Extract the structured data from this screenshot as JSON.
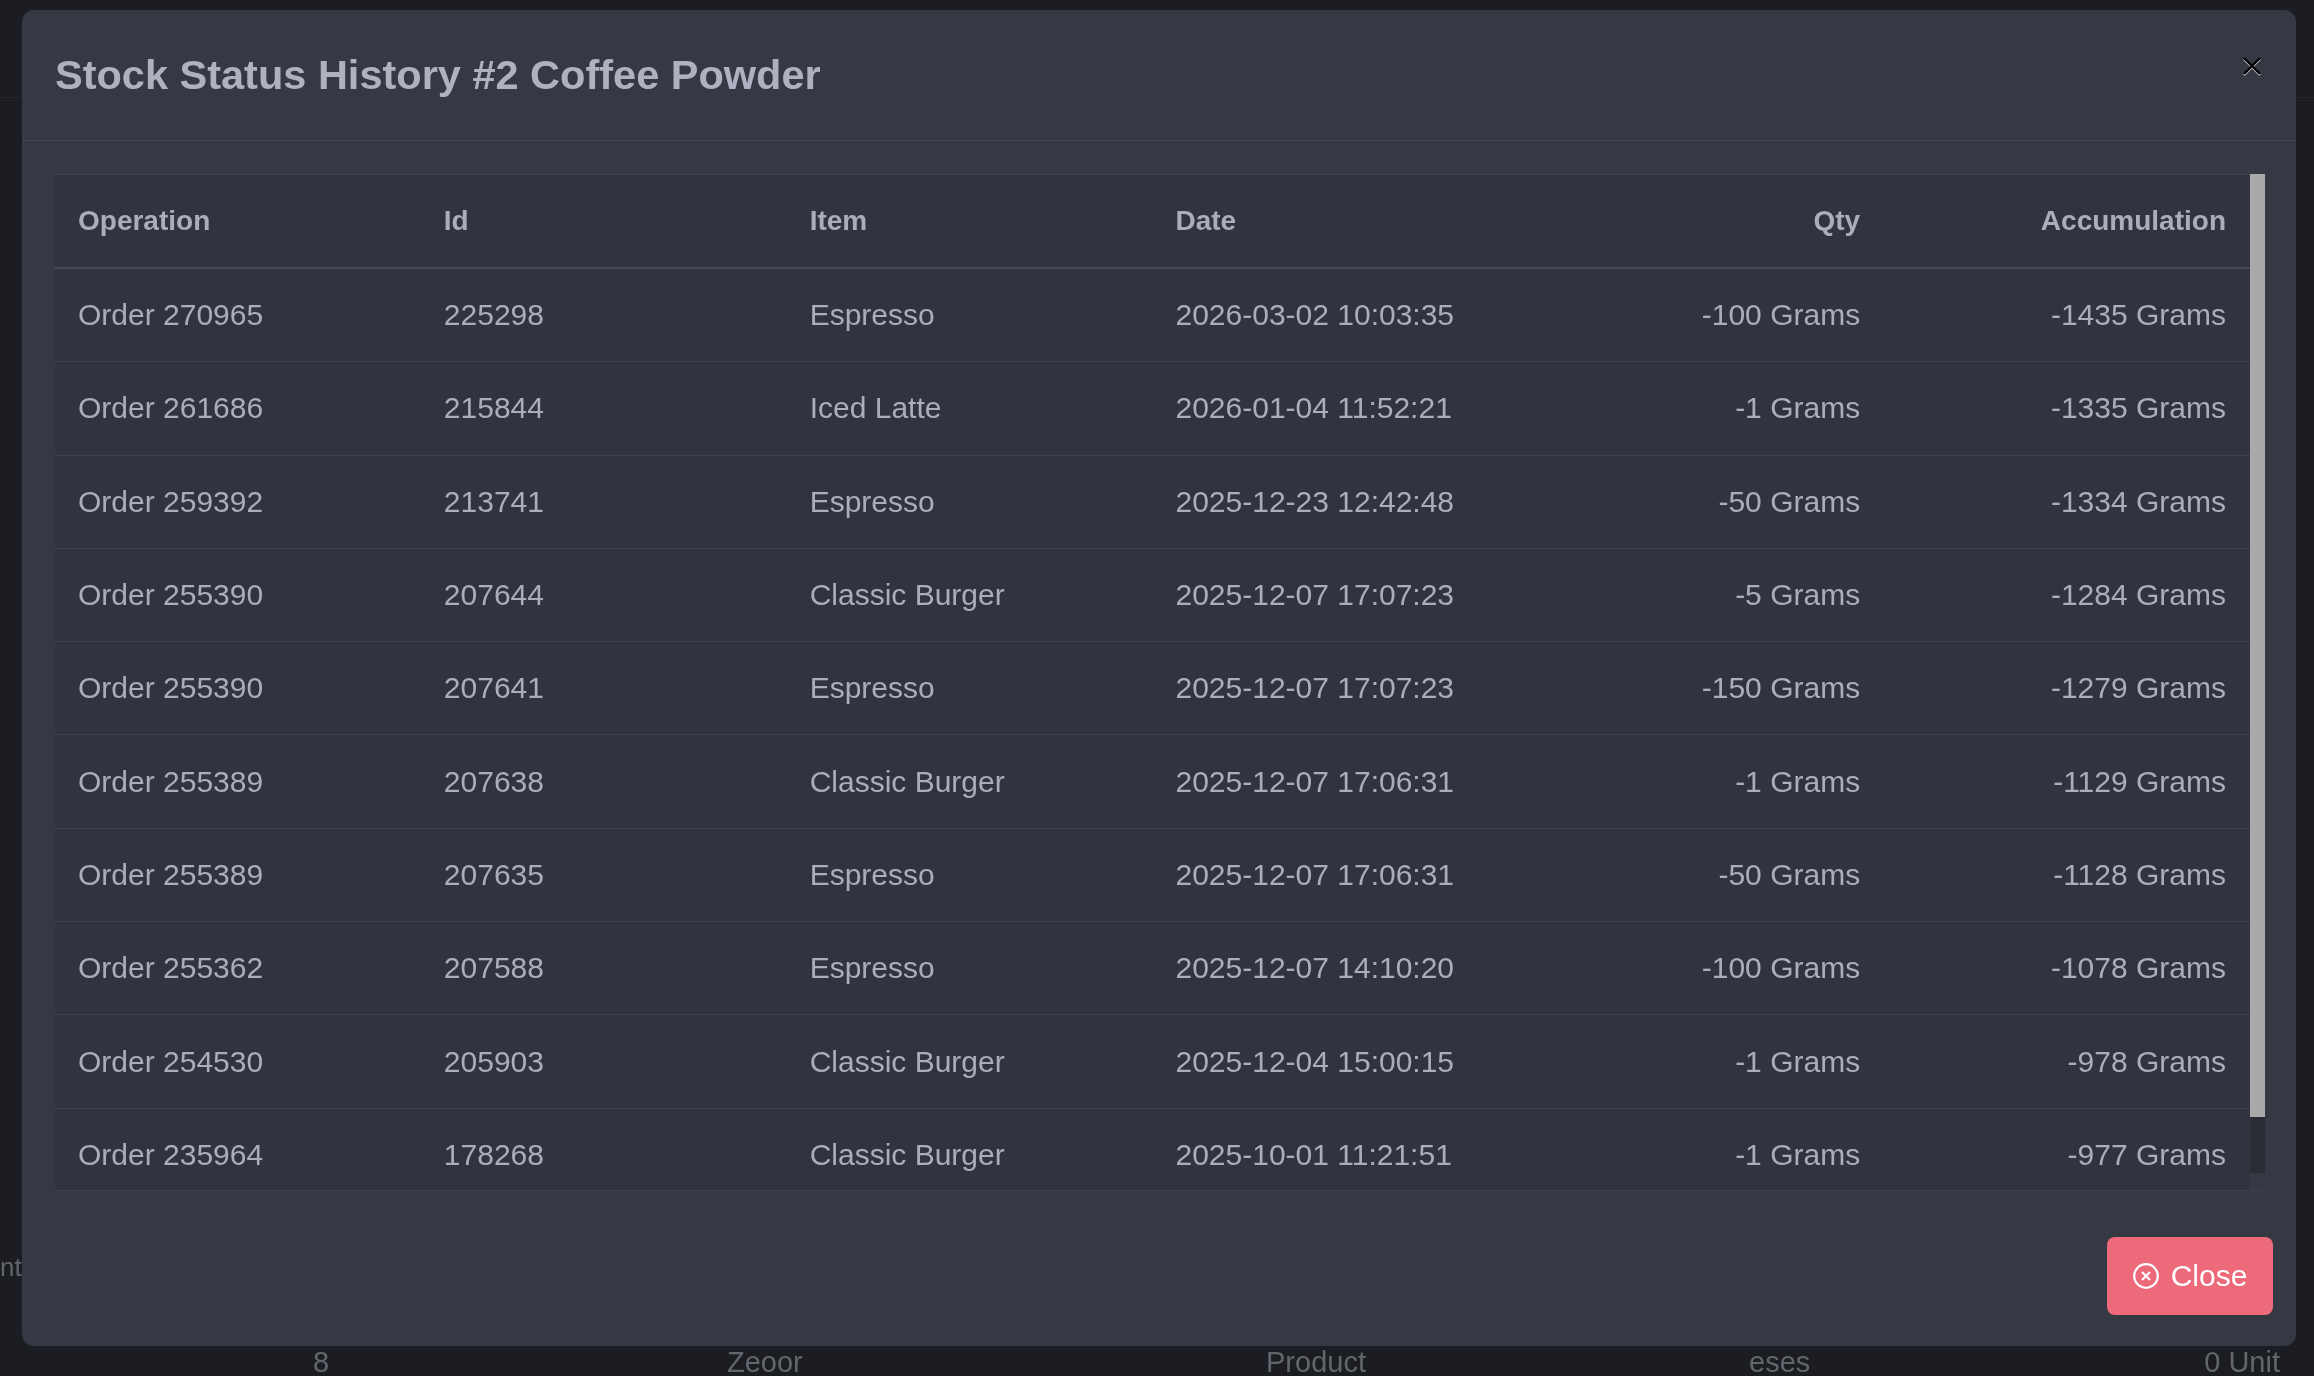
{
  "background": {
    "side_label": "nt",
    "bottom_row": [
      "8",
      "Zeoor",
      "Product",
      "eses",
      "0 Unit"
    ]
  },
  "modal": {
    "title": "Stock Status History #2 Coffee Powder",
    "table": {
      "columns": [
        {
          "label": "Operation",
          "kind": "text"
        },
        {
          "label": "Id",
          "kind": "text"
        },
        {
          "label": "Item",
          "kind": "text"
        },
        {
          "label": "Date",
          "kind": "text"
        },
        {
          "label": "Qty",
          "kind": "number"
        },
        {
          "label": "Accumulation",
          "kind": "number"
        }
      ],
      "rows": [
        [
          "Order 270965",
          "225298",
          "Espresso",
          "2026-03-02 10:03:35",
          "-100 Grams",
          "-1435 Grams"
        ],
        [
          "Order 261686",
          "215844",
          "Iced Latte",
          "2026-01-04 11:52:21",
          "-1 Grams",
          "-1335 Grams"
        ],
        [
          "Order 259392",
          "213741",
          "Espresso",
          "2025-12-23 12:42:48",
          "-50 Grams",
          "-1334 Grams"
        ],
        [
          "Order 255390",
          "207644",
          "Classic Burger",
          "2025-12-07 17:07:23",
          "-5 Grams",
          "-1284 Grams"
        ],
        [
          "Order 255390",
          "207641",
          "Espresso",
          "2025-12-07 17:07:23",
          "-150 Grams",
          "-1279 Grams"
        ],
        [
          "Order 255389",
          "207638",
          "Classic Burger",
          "2025-12-07 17:06:31",
          "-1 Grams",
          "-1129 Grams"
        ],
        [
          "Order 255389",
          "207635",
          "Espresso",
          "2025-12-07 17:06:31",
          "-50 Grams",
          "-1128 Grams"
        ],
        [
          "Order 255362",
          "207588",
          "Espresso",
          "2025-12-07 14:10:20",
          "-100 Grams",
          "-1078 Grams"
        ],
        [
          "Order 254530",
          "205903",
          "Classic Burger",
          "2025-12-04 15:00:15",
          "-1 Grams",
          "-978 Grams"
        ],
        [
          "Order 235964",
          "178268",
          "Classic Burger",
          "2025-10-01 11:21:51",
          "-1 Grams",
          "-977 Grams"
        ]
      ]
    },
    "footer": {
      "close_button": "Close"
    }
  }
}
